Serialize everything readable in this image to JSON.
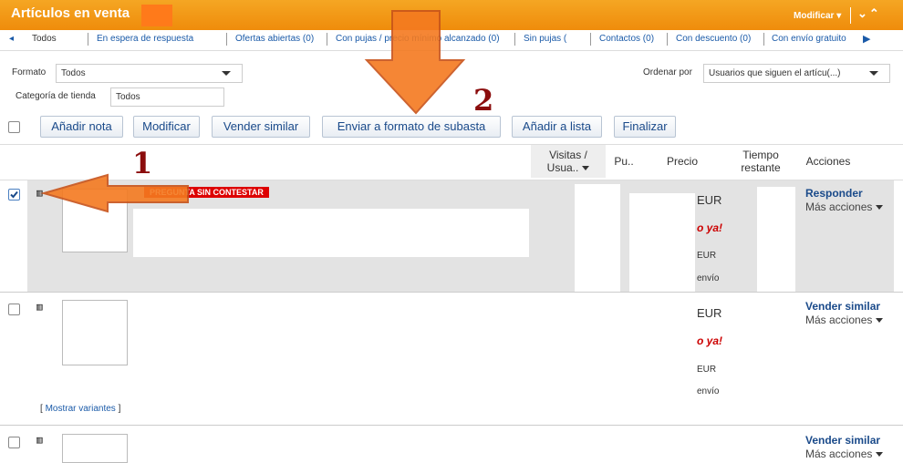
{
  "header": {
    "title": "Artículos en venta",
    "modify_label": "Modificar",
    "accent": "#f39c12"
  },
  "tabs": [
    "Todos",
    "En espera de respuesta",
    "Ofertas abiertas (0)",
    "Con pujas / precio mínimo alcanzado (0)",
    "Sin pujas (",
    "Contactos (0)",
    "Con descuento (0)",
    "Con envío gratuito"
  ],
  "filters": {
    "format_label": "Formato",
    "format_value": "Todos",
    "category_label": "Categoría de tienda",
    "category_value": "Todos",
    "sort_label": "Ordenar por",
    "sort_value": "Usuarios que siguen el artícu(...)"
  },
  "actions": {
    "add_note": "Añadir nota",
    "modify": "Modificar",
    "sell_similar": "Vender similar",
    "send_to_auction": "Enviar a formato de subasta",
    "add_to_list": "Añadir a lista",
    "finish": "Finalizar"
  },
  "columns": {
    "visits": "Visitas /",
    "visits2": "Usua..",
    "pu": "Pu..",
    "price": "Precio",
    "time1": "Tiempo",
    "time2": "restante",
    "actions": "Acciones"
  },
  "rows": [
    {
      "badge": "PREGUNTA SIN CONTESTAR",
      "price": "EUR",
      "buy_now": "o ya!",
      "price2": "EUR",
      "shipping": "envío",
      "action": "Responder",
      "more": "Más acciones",
      "checked": true
    },
    {
      "price": "EUR",
      "buy_now": "o ya!",
      "price2": "EUR",
      "shipping": "envío",
      "action": "Vender similar",
      "more": "Más acciones",
      "variants_prefix": "[",
      "variants_link": "Mostrar variantes",
      "variants_suffix": "]",
      "checked": false
    },
    {
      "action": "Vender similar",
      "more": "Más acciones",
      "checked": false
    }
  ],
  "annotations": {
    "step1": "1",
    "step2": "2",
    "arrow_color": "#f47a20",
    "number_color": "#8b0d0d"
  }
}
